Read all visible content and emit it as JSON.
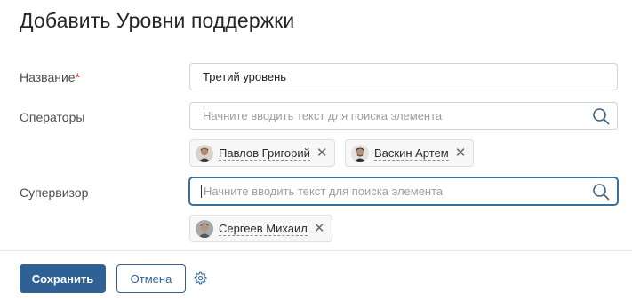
{
  "dialog": {
    "title": "Добавить Уровни поддержки"
  },
  "form": {
    "name": {
      "label": "Название",
      "required_mark": "*",
      "value": "Третий уровень"
    },
    "operators": {
      "label": "Операторы",
      "placeholder": "Начните вводить текст для поиска элемента",
      "selected": [
        {
          "name": "Павлов Григорий"
        },
        {
          "name": "Васкин Артем"
        }
      ]
    },
    "supervisor": {
      "label": "Супервизор",
      "placeholder": "Начните вводить текст для поиска элемента",
      "selected": [
        {
          "name": "Сергеев Михаил"
        }
      ]
    }
  },
  "footer": {
    "save_label": "Сохранить",
    "cancel_label": "Отмена"
  },
  "icons": {
    "search": "search-icon",
    "remove": "close-icon",
    "settings": "gear-icon"
  },
  "colors": {
    "primary": "#2f6195",
    "focus_border": "#3b6e9c",
    "required": "#d0312d"
  }
}
